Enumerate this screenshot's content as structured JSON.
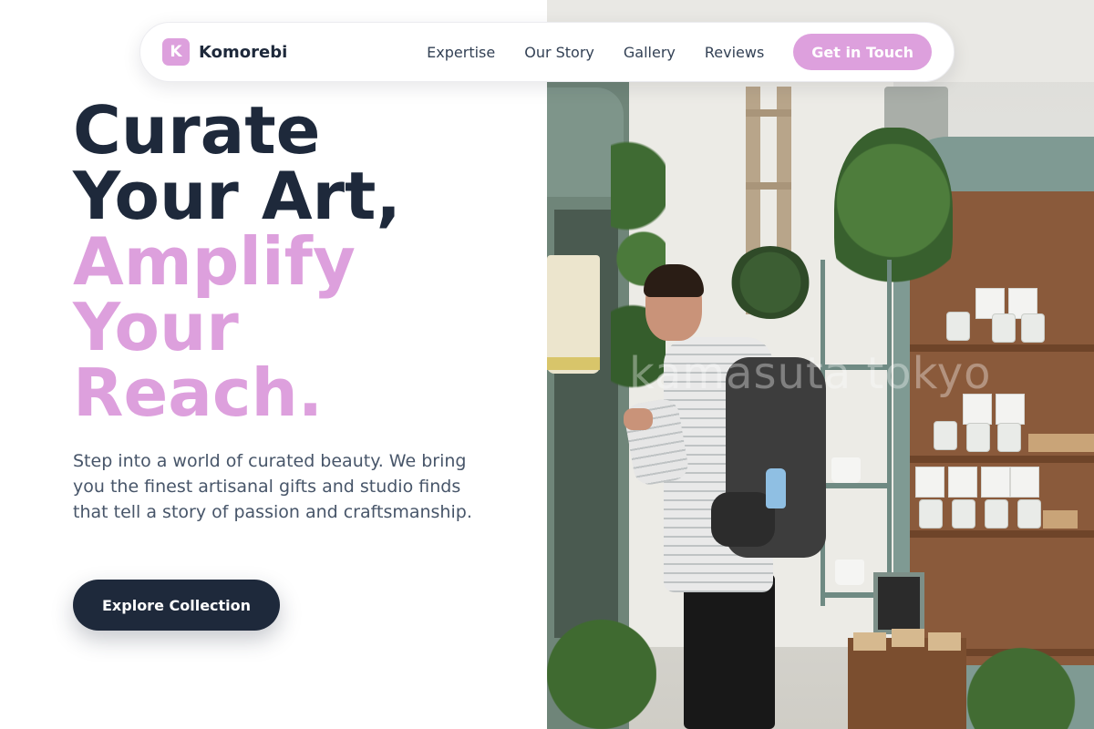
{
  "nav": {
    "logo_letter": "K",
    "brand": "Komorebi",
    "links": [
      "Expertise",
      "Our Story",
      "Gallery",
      "Reviews"
    ],
    "cta_label": "Get in Touch"
  },
  "hero": {
    "headline_dark": [
      "Curate",
      "Your Art,"
    ],
    "headline_accent": [
      "Amplify",
      "Your",
      "Reach."
    ],
    "description": "Step into a world of curated beauty. We bring you the finest artisanal gifts and studio finds that tell a story of passion and craftsmanship.",
    "button_label": "Explore Collection"
  },
  "photo": {
    "watermark": "kamasuta tokyo"
  },
  "colors": {
    "accent": "#dda0dd",
    "dark": "#1e293b",
    "body_text": "#475569",
    "nav_text": "#334155"
  }
}
